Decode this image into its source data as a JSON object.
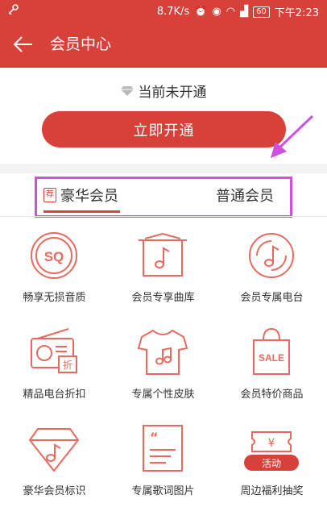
{
  "statusbar": {
    "speed": "8.7K/s",
    "battery": "60",
    "time": "下午2:23"
  },
  "appbar": {
    "title": "会员中心",
    "back_icon": "back-arrow-icon"
  },
  "vip": {
    "status_text": "当前未开通",
    "open_button": "立即开通"
  },
  "tabs": {
    "luxury_tag": "荐",
    "luxury_label": "豪华会员",
    "normal_label": "普通会员",
    "active": "luxury"
  },
  "benefits": [
    {
      "label": "畅享无损音质",
      "icon": "sq-quality-icon",
      "icon_text": "SQ"
    },
    {
      "label": "会员专享曲库",
      "icon": "music-library-icon"
    },
    {
      "label": "会员专属电台",
      "icon": "radio-disc-icon"
    },
    {
      "label": "精品电台折扣",
      "icon": "radio-discount-icon",
      "icon_text": "折"
    },
    {
      "label": "专属个性皮肤",
      "icon": "tshirt-skin-icon"
    },
    {
      "label": "会员特价商品",
      "icon": "sale-bag-icon",
      "icon_text": "SALE"
    },
    {
      "label": "豪华会员标识",
      "icon": "diamond-badge-icon"
    },
    {
      "label": "专属歌词图片",
      "icon": "lyrics-card-icon"
    },
    {
      "label": "周边福利抽奖",
      "icon": "lottery-ticket-icon",
      "icon_text": "¥",
      "badge": "活动"
    }
  ],
  "colors": {
    "primary": "#d8403a",
    "icon_stroke": "#e8695f",
    "highlight": "#d04fe0"
  }
}
